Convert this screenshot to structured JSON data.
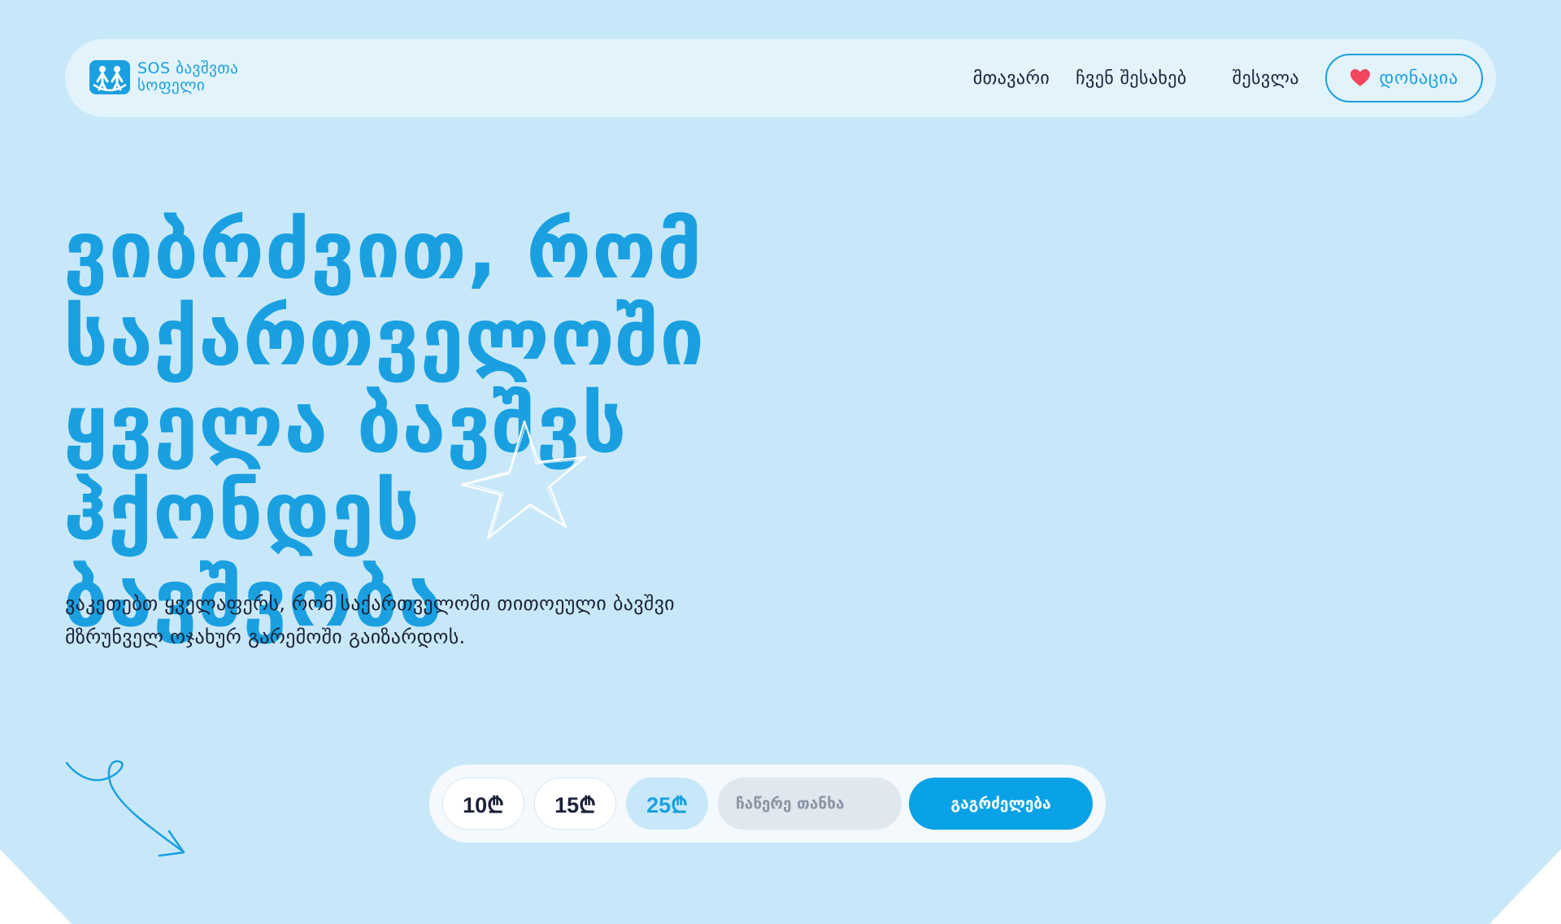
{
  "header": {
    "logo_line1": "SOS ბავშვთა",
    "logo_line2": "სოფელი",
    "nav": {
      "home": "მთავარი",
      "about": "ჩვენ შესახებ",
      "login": "შესვლა",
      "donate": "დონაცია"
    }
  },
  "hero": {
    "title_lines": [
      "ვიბრძვით, რომ",
      "საქართველოში",
      "ყველა ბავშვს",
      "ჰქონდეს",
      "ბავშვობა"
    ],
    "subtitle_lines": [
      "ვაკეთებთ ყველაფერს, რომ საქართველოში თითოეული ბავშვი",
      "მზრუნველ ოჯახურ გარემოში გაიზარდოს."
    ]
  },
  "donation": {
    "amounts": [
      "10₾",
      "15₾",
      "25₾"
    ],
    "selected_amount": "25₾",
    "custom_placeholder": "ჩაწერე თანხა",
    "continue_label": "გაგრძელება"
  },
  "icons": [
    "sos-logo-icon",
    "heart-icon",
    "star-doodle-icon",
    "curly-arrow-icon"
  ],
  "colors": {
    "background": "#c8e8f9",
    "accent": "#1aa0e0",
    "button": "#0aa2e6",
    "heart": "#f0465e",
    "text_dark": "#1b2238"
  }
}
